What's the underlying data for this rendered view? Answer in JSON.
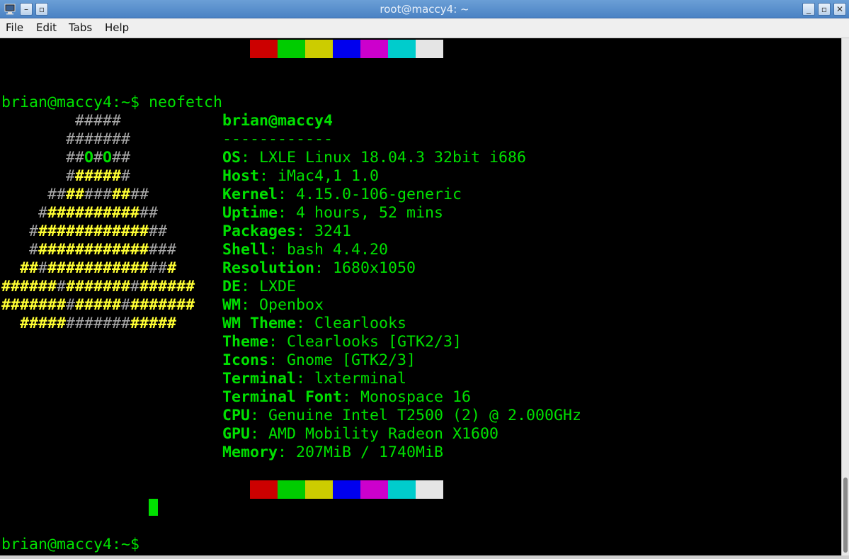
{
  "window": {
    "title": "root@maccy4: ~",
    "buttons": {
      "shade": "–",
      "sticky": "▫",
      "minimize": "_",
      "maximize": "▫",
      "close": "✕"
    }
  },
  "menu": {
    "file": "File",
    "edit": "Edit",
    "tabs": "Tabs",
    "help": "Help"
  },
  "terminal": {
    "prompt": "brian@maccy4:~$ ",
    "command": "neofetch",
    "header": "brian@maccy4",
    "separator": "------------",
    "info": [
      {
        "key": "OS",
        "value": ": LXLE Linux 18.04.3 32bit i686"
      },
      {
        "key": "Host",
        "value": ": iMac4,1 1.0"
      },
      {
        "key": "Kernel",
        "value": ": 4.15.0-106-generic"
      },
      {
        "key": "Uptime",
        "value": ": 4 hours, 52 mins"
      },
      {
        "key": "Packages",
        "value": ": 3241"
      },
      {
        "key": "Shell",
        "value": ": bash 4.4.20"
      },
      {
        "key": "Resolution",
        "value": ": 1680x1050"
      },
      {
        "key": "DE",
        "value": ": LXDE"
      },
      {
        "key": "WM",
        "value": ": Openbox"
      },
      {
        "key": "WM Theme",
        "value": ": Clearlooks"
      },
      {
        "key": "Theme",
        "value": ": Clearlooks [GTK2/3]"
      },
      {
        "key": "Icons",
        "value": ": Gnome [GTK2/3]"
      },
      {
        "key": "Terminal",
        "value": ": lxterminal"
      },
      {
        "key": "Terminal Font",
        "value": ": Monospace 16"
      },
      {
        "key": "CPU",
        "value": ": Genuine Intel T2500 (2) @ 2.000GHz"
      },
      {
        "key": "GPU",
        "value": ": AMD Mobility Radeon X1600"
      },
      {
        "key": "Memory",
        "value": ": 207MiB / 1740MiB"
      }
    ],
    "palette": [
      "#cc0000",
      "#00cc00",
      "#cccc00",
      "#0000ee",
      "#cc00cc",
      "#00cccc",
      "#e5e5e5"
    ],
    "ascii_logo": [
      [
        [
          "grey",
          "        #####"
        ]
      ],
      [
        [
          "grey",
          "       #######"
        ]
      ],
      [
        [
          "grey",
          "       ##"
        ],
        [
          "greenb",
          "O"
        ],
        [
          "grey",
          "#"
        ],
        [
          "greenb",
          "O"
        ],
        [
          "grey",
          "##"
        ]
      ],
      [
        [
          "grey",
          "       #"
        ],
        [
          "yb",
          "#####"
        ],
        [
          "grey",
          "#"
        ]
      ],
      [
        [
          "grey",
          "     ##"
        ],
        [
          "yb",
          "##"
        ],
        [
          "grey",
          "###"
        ],
        [
          "yb",
          "##"
        ],
        [
          "grey",
          "##"
        ]
      ],
      [
        [
          "grey",
          "    #"
        ],
        [
          "yb",
          "##########"
        ],
        [
          "grey",
          "##"
        ]
      ],
      [
        [
          "grey",
          "   #"
        ],
        [
          "yb",
          "############"
        ],
        [
          "grey",
          "##"
        ]
      ],
      [
        [
          "grey",
          "   #"
        ],
        [
          "yb",
          "############"
        ],
        [
          "grey",
          "###"
        ]
      ],
      [
        [
          "yb",
          "  ##"
        ],
        [
          "grey",
          "#"
        ],
        [
          "yb",
          "###########"
        ],
        [
          "grey",
          "##"
        ],
        [
          "yb",
          "#"
        ]
      ],
      [
        [
          "yb",
          "######"
        ],
        [
          "grey",
          "#"
        ],
        [
          "yb",
          "#######"
        ],
        [
          "grey",
          "#"
        ],
        [
          "yb",
          "######"
        ]
      ],
      [
        [
          "yb",
          "#######"
        ],
        [
          "grey",
          "#"
        ],
        [
          "yb",
          "#####"
        ],
        [
          "grey",
          "#"
        ],
        [
          "yb",
          "#######"
        ]
      ],
      [
        [
          "yb",
          "  #####"
        ],
        [
          "grey",
          "#######"
        ],
        [
          "yb",
          "#####"
        ]
      ]
    ]
  }
}
